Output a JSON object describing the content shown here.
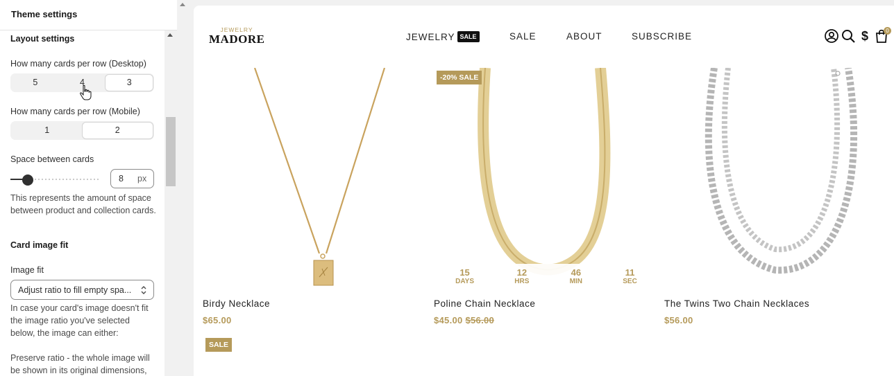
{
  "panel": {
    "title": "Theme settings",
    "section_title": "Layout settings",
    "desktop_label": "How many cards per row (Desktop)",
    "desktop_options": [
      "5",
      "4",
      "3"
    ],
    "mobile_label": "How many cards per row (Mobile)",
    "mobile_options": [
      "1",
      "2"
    ],
    "space_label": "Space between cards",
    "space_value": "8",
    "space_unit": "px",
    "space_help": "This represents the amount of space between product and collection cards.",
    "card_fit_title": "Card image fit",
    "image_fit_label": "Image fit",
    "image_fit_value": "Adjust ratio to fill empty spa...",
    "image_fit_help": "In case your card's image doesn't fit the image ratio you've selected below, the image can either:",
    "preserve_help": "Preserve ratio - the whole image will be shown in its original dimensions,"
  },
  "header": {
    "logo_top": "JEWELRY",
    "logo_main": "MADORE",
    "nav": [
      "JEWELRY",
      "SALE",
      "ABOUT",
      "SUBSCRIBE"
    ],
    "nav_badge": "SALE",
    "cart_count": "0",
    "icons": [
      "account-icon",
      "search-icon",
      "currency-icon",
      "cart-icon"
    ]
  },
  "products": [
    {
      "title": "Birdy Necklace",
      "price": "$65.00",
      "old_price": "",
      "badge": ""
    },
    {
      "title": "Poline Chain Necklace",
      "price": "$45.00",
      "old_price": "$56.00",
      "badge": "-20% SALE"
    },
    {
      "title": "The Twins Two Chain Necklaces",
      "price": "$56.00",
      "old_price": "",
      "badge": ""
    }
  ],
  "countdown": [
    {
      "num": "15",
      "unit": "DAYS"
    },
    {
      "num": "12",
      "unit": "HRS"
    },
    {
      "num": "46",
      "unit": "MIN"
    },
    {
      "num": "11",
      "unit": "SEC"
    }
  ],
  "next_row_badge": "SALE",
  "colors": {
    "accent": "#b59a5a",
    "text": "#222222",
    "panel_bg": "#f1f1f1"
  }
}
